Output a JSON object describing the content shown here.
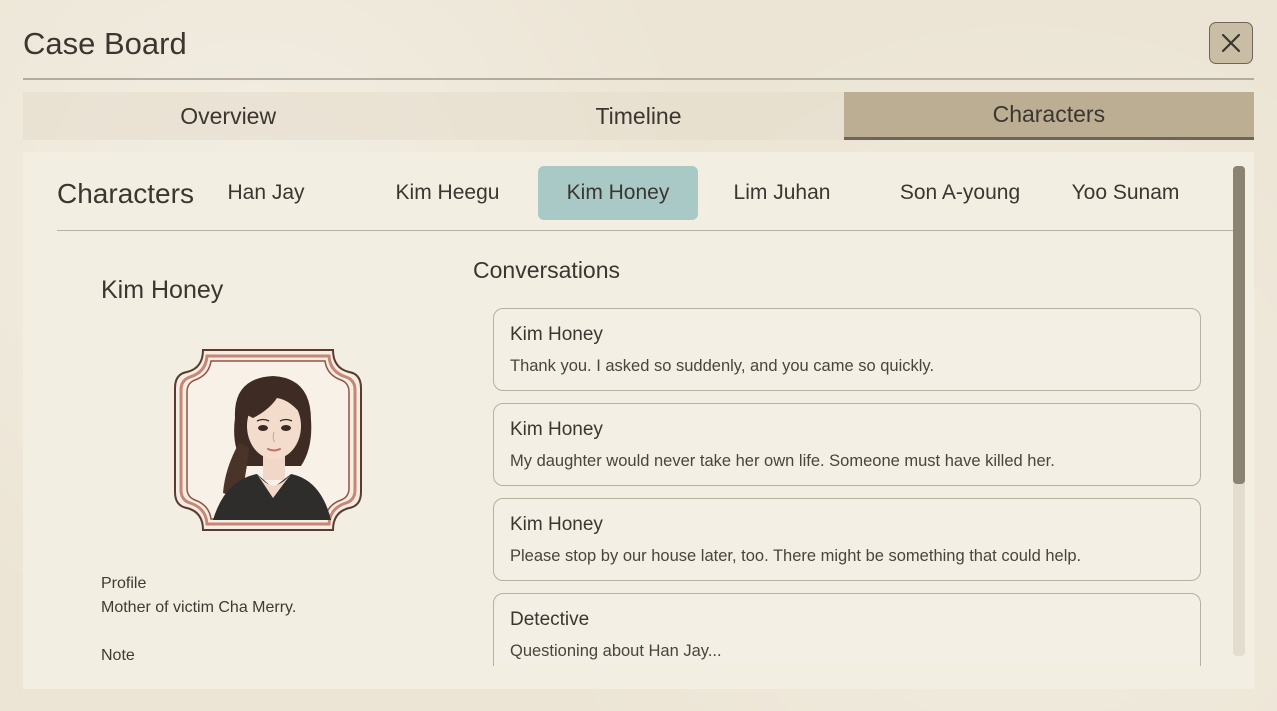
{
  "window": {
    "title": "Case Board",
    "close_icon": "close-icon"
  },
  "main_tabs": [
    {
      "label": "Overview",
      "active": false
    },
    {
      "label": "Timeline",
      "active": false
    },
    {
      "label": "Characters",
      "active": true
    }
  ],
  "characters_panel": {
    "heading": "Characters",
    "tabs": [
      {
        "label": "Han Jay",
        "active": false
      },
      {
        "label": "Kim Heegu",
        "active": false
      },
      {
        "label": "Kim Honey",
        "active": true
      },
      {
        "label": "Lim Juhan",
        "active": false
      },
      {
        "label": "Son A-young",
        "active": false
      },
      {
        "label": "Yoo Sunam",
        "active": false
      }
    ],
    "active_tab_color": "#a8c9c6"
  },
  "character": {
    "name": "Kim Honey",
    "portrait": "character-portrait",
    "profile_label": "Profile",
    "profile_text": "Mother of victim Cha Merry.",
    "note_label": "Note"
  },
  "conversations": {
    "heading": "Conversations",
    "items": [
      {
        "speaker": "Kim Honey",
        "text": "Thank you. I asked so suddenly, and you came so quickly."
      },
      {
        "speaker": "Kim Honey",
        "text": "My daughter would never take her own life. Someone must have killed her."
      },
      {
        "speaker": "Kim Honey",
        "text": "Please stop by our house later, too. There might be something that could help."
      },
      {
        "speaker": "Detective",
        "text": "Questioning about Han Jay..."
      }
    ]
  },
  "colors": {
    "background": "#ece5d5",
    "active_main_tab": "#bcae92",
    "text": "#3b3630"
  }
}
